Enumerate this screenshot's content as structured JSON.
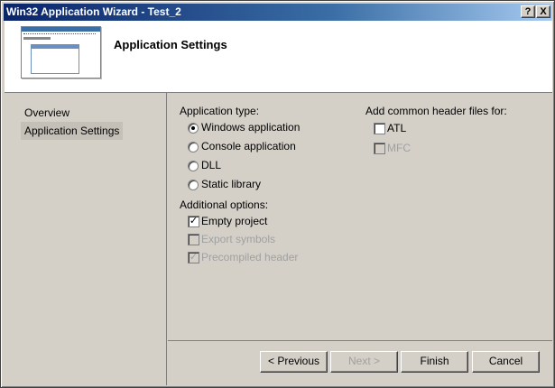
{
  "window": {
    "title": "Win32 Application Wizard - Test_2",
    "help_glyph": "?",
    "close_glyph": "X"
  },
  "banner": {
    "title": "Application Settings",
    "thumbnail_icon": "window-thumbnail-icon"
  },
  "sidebar": {
    "items": [
      {
        "label": "Overview",
        "selected": false
      },
      {
        "label": "Application Settings",
        "selected": true
      }
    ]
  },
  "application_type": {
    "label": "Application type:",
    "options": [
      {
        "label": "Windows application",
        "checked": true
      },
      {
        "label": "Console application",
        "checked": false
      },
      {
        "label": "DLL",
        "checked": false
      },
      {
        "label": "Static library",
        "checked": false
      }
    ]
  },
  "additional_options": {
    "label": "Additional options:",
    "options": [
      {
        "label": "Empty project",
        "checked": true,
        "enabled": true
      },
      {
        "label": "Export symbols",
        "checked": false,
        "enabled": false
      },
      {
        "label": "Precompiled header",
        "checked": true,
        "enabled": false
      }
    ]
  },
  "common_headers": {
    "label": "Add common header files for:",
    "options": [
      {
        "label": "ATL",
        "checked": false,
        "enabled": true
      },
      {
        "label": "MFC",
        "checked": false,
        "enabled": false
      }
    ]
  },
  "footer": {
    "previous_label": "< Previous",
    "next_label": "Next >",
    "finish_label": "Finish",
    "cancel_label": "Cancel"
  },
  "colors": {
    "title_gradient_start": "#0a246a",
    "title_gradient_end": "#a6caf0",
    "dialog_face": "#d4d0c8",
    "disabled_text": "#a0a0a0"
  }
}
